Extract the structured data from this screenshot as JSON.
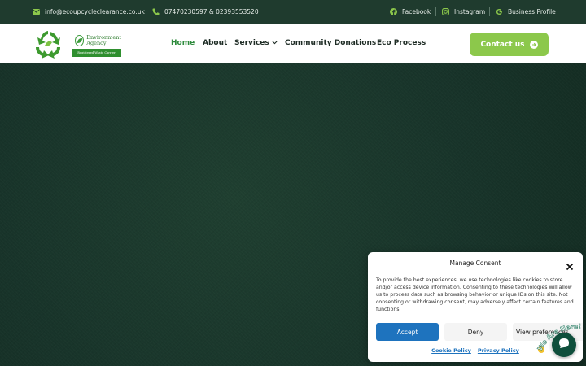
{
  "topbar": {
    "email": "info@ecoupcycleclearance.co.uk",
    "phone": "07470230597 & 02393553520",
    "social": [
      {
        "label": "Facebook",
        "icon": "facebook-icon"
      },
      {
        "label": "Instagram",
        "icon": "instagram-icon"
      },
      {
        "label": "Business Profile",
        "icon": "google-icon"
      }
    ]
  },
  "header": {
    "badge": {
      "name_line1": "Environment",
      "name_line2": "Agency",
      "strip": "Registered Waste Carrier"
    },
    "nav": [
      {
        "label": "Home",
        "active": true
      },
      {
        "label": "About"
      },
      {
        "label": "Services"
      },
      {
        "label": "Community Donations"
      },
      {
        "label": "Eco Process"
      }
    ],
    "contact_label": "Contact us"
  },
  "consent": {
    "title": "Manage Consent",
    "body": "To provide the best experiences, we use technologies like cookies to store and/or access device information. Consenting to these technologies will allow us to process data such as browsing behavior or unique IDs on this site. Not consenting or withdrawing consent, may adversely affect certain features and functions.",
    "accept": "Accept",
    "deny": "Deny",
    "view": "View preferences",
    "cookie_policy": "Cookie Policy",
    "privacy_policy": "Privacy Policy"
  },
  "chat": {
    "wave_text": "We Are Here!"
  },
  "colors": {
    "brand_green": "#8cc84b",
    "dark_green": "#1f3b2e",
    "accept_blue": "#1e73be"
  }
}
